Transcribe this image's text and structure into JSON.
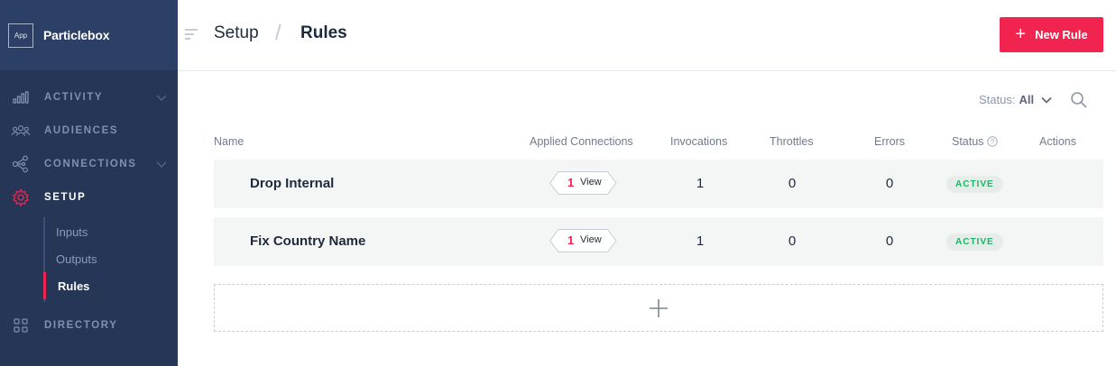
{
  "sidebar": {
    "app_badge": "App",
    "brand": "Particlebox",
    "nav": [
      {
        "label": "ACTIVITY",
        "icon": "bar-chart-icon"
      },
      {
        "label": "AUDIENCES",
        "icon": "people-icon"
      },
      {
        "label": "CONNECTIONS",
        "icon": "network-icon"
      },
      {
        "label": "SETUP",
        "icon": "gear-icon"
      },
      {
        "label": "DIRECTORY",
        "icon": "grid-icon"
      }
    ],
    "subnav": [
      {
        "label": "Inputs"
      },
      {
        "label": "Outputs"
      },
      {
        "label": "Rules"
      }
    ]
  },
  "header": {
    "crumb_parent": "Setup",
    "crumb_separator": "/",
    "crumb_current": "Rules",
    "new_rule_label": "New Rule"
  },
  "filter": {
    "status_label": "Status:",
    "status_value": "All"
  },
  "table": {
    "columns": [
      "Name",
      "Applied Connections",
      "Invocations",
      "Throttles",
      "Errors",
      "Status",
      "Actions"
    ],
    "rows": [
      {
        "name": "Drop Internal",
        "connections": "1",
        "view_label": "View",
        "invocations": "1",
        "throttles": "0",
        "errors": "0",
        "status": "ACTIVE"
      },
      {
        "name": "Fix Country Name",
        "connections": "1",
        "view_label": "View",
        "invocations": "1",
        "throttles": "0",
        "errors": "0",
        "status": "ACTIVE"
      }
    ]
  },
  "colors": {
    "sidebar_bg": "#253656",
    "accent": "#f0244f",
    "active_status": "#1fb466"
  }
}
